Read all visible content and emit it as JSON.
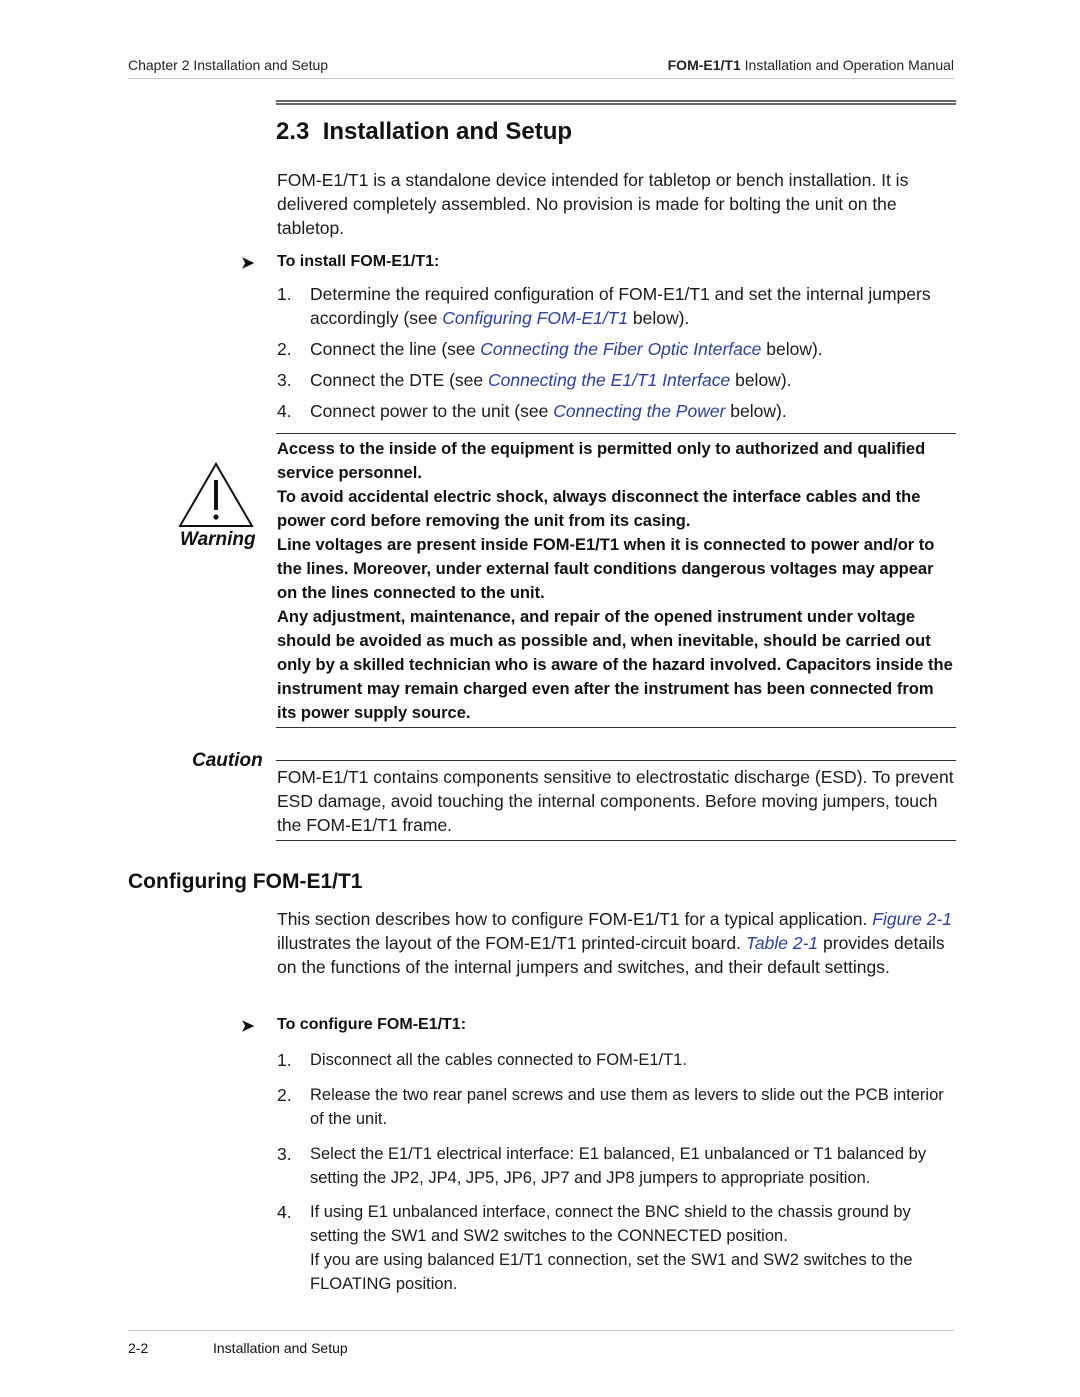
{
  "header": {
    "left": "Chapter 2  Installation and Setup",
    "right_bold": "FOM-E1/T1",
    "right_rest": " Installation and Operation Manual"
  },
  "section": {
    "title": "2.3  Installation and Setup",
    "intro": "FOM-E1/T1 is a standalone device intended for tabletop or bench installation. It is delivered completely assembled. No provision is made for bolting the unit on the tabletop.",
    "procedure_title": "To install FOM-E1/T1:",
    "steps": [
      {
        "num": "1.",
        "pre": "Determine the required configuration of FOM-E1/T1 and set the internal jumpers accordingly (see ",
        "link": "Configuring FOM-E1/T1",
        "post": " below)."
      },
      {
        "num": "2.",
        "pre": "Connect the line (see ",
        "link": "Connecting the Fiber Optic Interface",
        "post": " below)."
      },
      {
        "num": "3.",
        "pre": "Connect the DTE (see ",
        "link": "Connecting the E1/T1 Interface",
        "post": " below)."
      },
      {
        "num": "4.",
        "pre": "Connect power to the unit (see ",
        "link": "Connecting the Power",
        "post": " below)."
      }
    ]
  },
  "warning": {
    "label": "Warning",
    "paragraphs": [
      "Access to the inside of the equipment is permitted only to authorized and qualified service personnel.",
      "To avoid accidental electric shock, always disconnect the interface cables and the power cord before removing the unit from its casing.",
      "Line voltages are present inside FOM-E1/T1 when it is connected to power and/or to the lines. Moreover, under external fault conditions dangerous voltages may appear on the lines connected to the unit.",
      "Any adjustment, maintenance, and repair of the opened instrument under voltage should be avoided as much as possible and, when inevitable, should be carried out only by a skilled technician who is aware of the hazard involved. Capacitors inside the instrument may remain charged even after the instrument has been connected from its power supply source."
    ]
  },
  "caution": {
    "label": "Caution",
    "text": "FOM-E1/T1 contains components sensitive to electrostatic discharge (ESD). To prevent ESD damage, avoid touching the internal components. Before moving jumpers, touch the FOM-E1/T1 frame."
  },
  "configuring": {
    "title": "Configuring FOM-E1/T1",
    "intro_pre": "This section describes how to configure FOM-E1/T1 for a typical application. ",
    "figure_link": "Figure 2-1",
    "intro_mid": " illustrates the layout of the FOM-E1/T1 printed-circuit board. ",
    "table_link": "Table 2-1",
    "intro_post": " provides details on the functions of the internal jumpers and switches, and their default settings.",
    "procedure_title": "To configure FOM-E1/T1:",
    "steps": [
      {
        "num": "1.",
        "text": "Disconnect all the cables connected to FOM-E1/T1."
      },
      {
        "num": "2.",
        "text": "Release the two rear panel screws and use them as levers to slide out the PCB interior of the unit."
      },
      {
        "num": "3.",
        "text": "Select the E1/T1 electrical interface: E1 balanced, E1 unbalanced or T1 balanced by setting the JP2, JP4, JP5, JP6, JP7 and JP8 jumpers to appropriate position."
      },
      {
        "num": "4.",
        "text": "If using E1 unbalanced interface, connect the BNC shield to the chassis ground by setting the SW1 and SW2 switches to the CONNECTED position.",
        "text2": "If you are using balanced E1/T1 connection, set the SW1 and SW2 switches to the FLOATING position."
      }
    ]
  },
  "footer": {
    "page": "2-2",
    "title": "Installation and Setup"
  },
  "icons": {
    "procedure": "arrowhead-icon",
    "warning": "warning-triangle-icon"
  }
}
